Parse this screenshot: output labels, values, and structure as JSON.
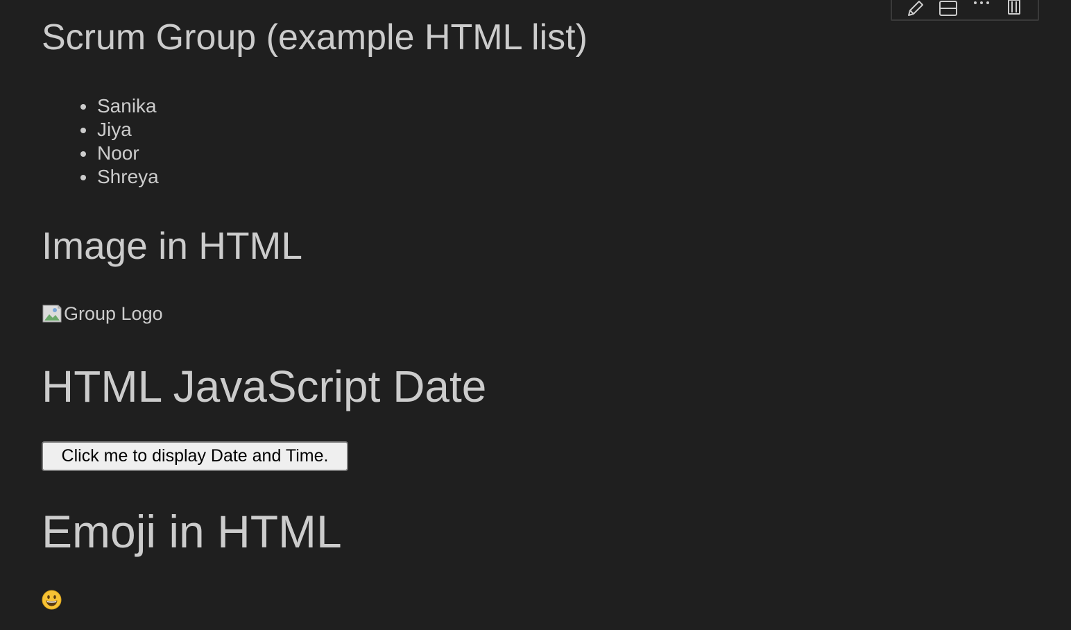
{
  "toolbar": {
    "buttons": [
      {
        "icon": "pencil-icon"
      },
      {
        "icon": "split-layout-icon"
      },
      {
        "icon": "more-icon"
      },
      {
        "icon": "trash-icon"
      }
    ]
  },
  "title": "Scrum Group (example HTML list)",
  "members": [
    "Sanika",
    "Jiya",
    "Noor",
    "Shreya"
  ],
  "image_section": {
    "heading": "Image in HTML",
    "logo_alt": "Group Logo"
  },
  "date_section": {
    "heading": "HTML JavaScript Date",
    "button_label": "Click me to display Date and Time."
  },
  "emoji_section": {
    "heading": "Emoji in HTML",
    "emoji": "grinning-face"
  },
  "colors": {
    "background": "#1f1f1f",
    "text": "#cccccc",
    "button_bg": "#efefef"
  }
}
